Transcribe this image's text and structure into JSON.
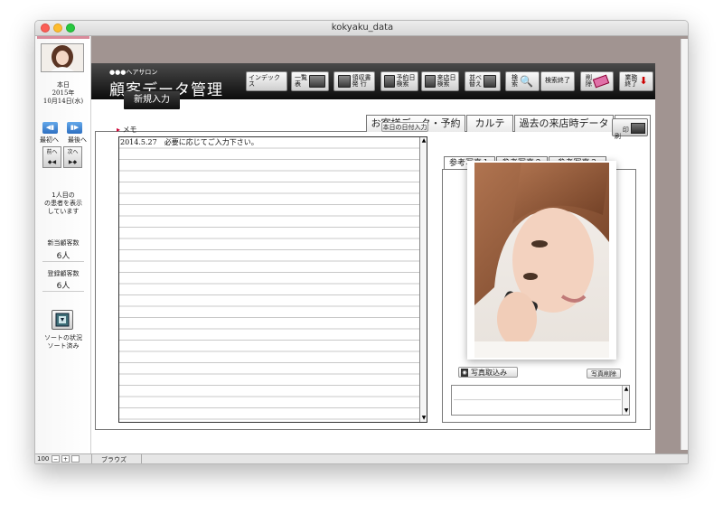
{
  "window": {
    "title": "kokyaku_data"
  },
  "sidebar": {
    "today_label": "本日",
    "date_year": "2015年",
    "date_md": "10月14日(水)",
    "first_label": "最初へ",
    "last_label": "最後へ",
    "prev_label": "前へ",
    "next_label": "次へ",
    "showing_line1": "1人目の",
    "showing_line2": "の患者を表示",
    "showing_line3": "しています",
    "new_count_label": "新当顧客数",
    "new_count_value": "6人",
    "registered_label": "登録顧客数",
    "registered_value": "6人",
    "sort_status_label": "ソートの状況",
    "sort_status_value": "ソート済み"
  },
  "header": {
    "subtitle": "●●●ヘアサロン",
    "title": "顧客データ管理",
    "buttons": {
      "index": "インデックス",
      "list": "一覧\n表",
      "receipt": "領収書\n発 行",
      "reservation_search": "予約日\n検索",
      "visit_search": "来店日\n検索",
      "sort": "並べ\n替え",
      "search": "検\n索",
      "search_end": "検索終了",
      "delete": "削\n除",
      "exit": "業務\n終了"
    }
  },
  "new_entry_button": "新規入力",
  "tabs": [
    "お客様データ・予約",
    "カルテ",
    "過去の来店時データ",
    "メモ"
  ],
  "memo": {
    "label": "メモ",
    "today_date_button": "本日の日付入力",
    "first_line": "2014.5.27　必要に応じてご入力下さい。"
  },
  "print_button": "印\n刷",
  "photos": {
    "tabs": [
      "参考写真１",
      "参考写真２",
      "参考写真３"
    ],
    "import_button": "写真取込み",
    "delete_button": "写真削除"
  },
  "status": {
    "zoom": "100",
    "mode": "ブラウズ"
  },
  "colors": {
    "accent_blue": "#2f6fc0",
    "background_brown": "#a19491",
    "header_black": "#111111"
  }
}
